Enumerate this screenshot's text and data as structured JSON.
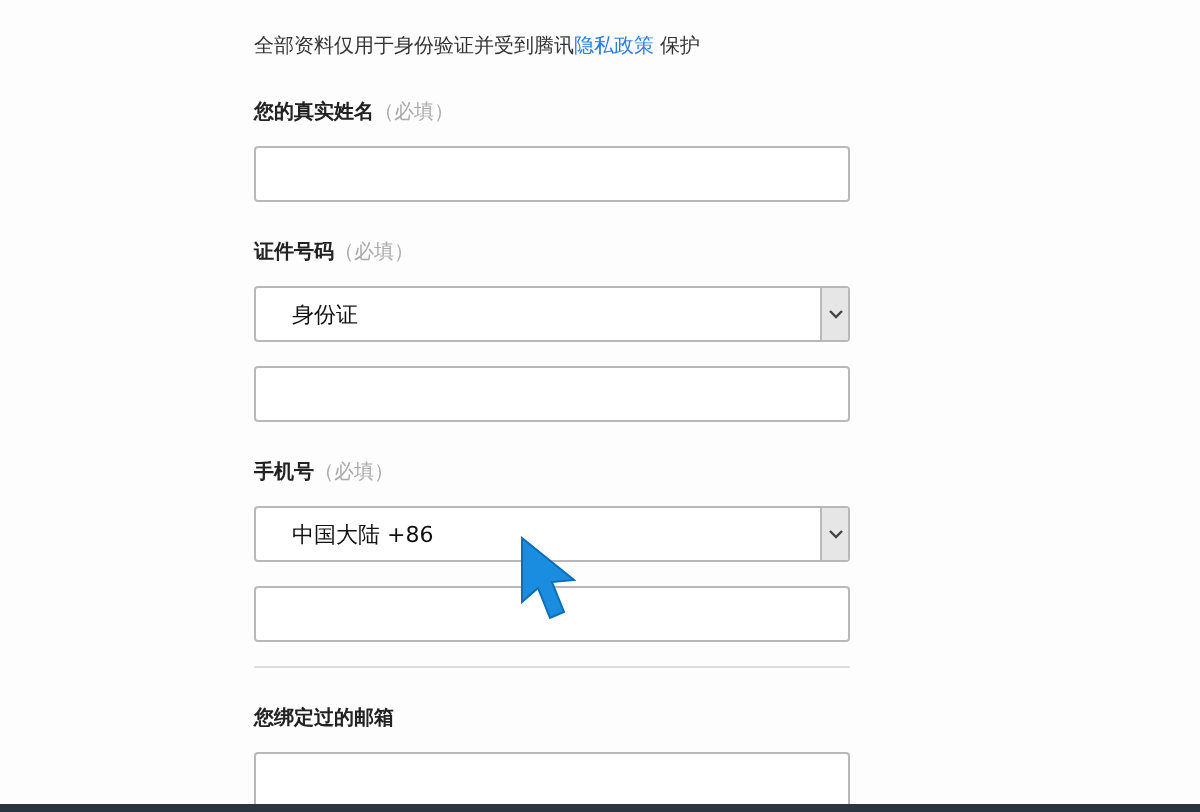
{
  "notice": {
    "text": "全部资料仅用于身份验证并受到腾讯",
    "link": "隐私政策",
    "after": "保护"
  },
  "groups": [
    {
      "kind": "field",
      "label": "您的真实姓名",
      "hint": "（必填）",
      "controls": [
        {
          "kind": "input"
        }
      ]
    },
    {
      "kind": "field",
      "label": "证件号码",
      "hint": "（必填）",
      "controls": [
        {
          "kind": "select",
          "value": "身份证"
        },
        {
          "kind": "input"
        }
      ]
    },
    {
      "kind": "field",
      "label": "手机号",
      "hint": "（必填）",
      "controls": [
        {
          "kind": "select",
          "value": "中国大陆 +86"
        },
        {
          "kind": "input"
        }
      ]
    },
    {
      "kind": "divider"
    },
    {
      "kind": "field",
      "label": "您绑定过的邮箱",
      "controls": [
        {
          "kind": "input"
        }
      ]
    }
  ]
}
